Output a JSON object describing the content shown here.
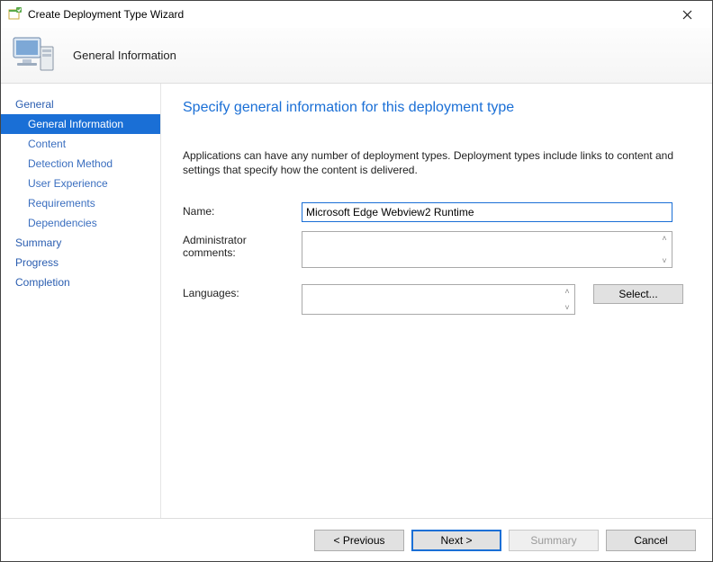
{
  "window": {
    "title": "Create Deployment Type Wizard"
  },
  "banner": {
    "heading": "General Information"
  },
  "sidebar": {
    "items": [
      {
        "label": "General",
        "type": "step"
      },
      {
        "label": "General Information",
        "type": "sub",
        "selected": true
      },
      {
        "label": "Content",
        "type": "sub"
      },
      {
        "label": "Detection Method",
        "type": "sub"
      },
      {
        "label": "User Experience",
        "type": "sub"
      },
      {
        "label": "Requirements",
        "type": "sub"
      },
      {
        "label": "Dependencies",
        "type": "sub"
      },
      {
        "label": "Summary",
        "type": "step"
      },
      {
        "label": "Progress",
        "type": "step"
      },
      {
        "label": "Completion",
        "type": "step"
      }
    ]
  },
  "page": {
    "heading": "Specify general information for this deployment type",
    "description": "Applications can have any number of deployment types. Deployment types include links to content and settings that specify how the content is delivered.",
    "labels": {
      "name": "Name:",
      "admin_comments": "Administrator comments:",
      "languages": "Languages:"
    },
    "fields": {
      "name": "Microsoft Edge Webview2 Runtime",
      "admin_comments": "",
      "languages": ""
    },
    "buttons": {
      "select": "Select..."
    }
  },
  "footer": {
    "previous": "< Previous",
    "next": "Next >",
    "summary": "Summary",
    "cancel": "Cancel"
  }
}
